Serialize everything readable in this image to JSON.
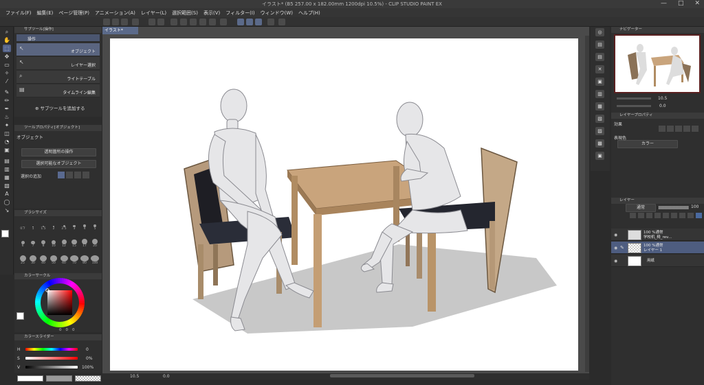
{
  "window": {
    "title": "イラスト* (B5 257.00 x 182.00mm 1200dpi 10.5%) - CLIP STUDIO PAINT EX",
    "controls": [
      "—",
      "□",
      "✕"
    ]
  },
  "menu": [
    "ファイル(F)",
    "編集(E)",
    "ページ管理(P)",
    "アニメーション(A)",
    "レイヤー(L)",
    "選択範囲(S)",
    "表示(V)",
    "フィルター(I)",
    "ウィンドウ(W)",
    "ヘルプ(H)"
  ],
  "subtool_panel": {
    "header": "サブツール[操作]",
    "group_label": "操作",
    "items": [
      "オブジェクト",
      "レイヤー選択",
      "ライトテーブル",
      "タイムライン編集"
    ],
    "add_label": "サブツールを追加する"
  },
  "tool_property": {
    "header": "ツールプロパティ[オブジェクト]",
    "title": "オブジェクト",
    "dropdown1": "透明箇所の操作",
    "dropdown2": "選択可能なオブジェクト",
    "selection_add_label": "選択の追加"
  },
  "brush_size": {
    "header": "ブラシサイズ",
    "sizes": [
      "0.7",
      "1",
      "1.5",
      "2",
      "2.5",
      "3",
      "4",
      "5",
      "6",
      "7",
      "8",
      "10",
      "12",
      "15",
      "17",
      "20",
      "25",
      "30",
      "40",
      "50",
      "60",
      "70",
      "80",
      "100"
    ]
  },
  "color_wheel": {
    "header": "カラーサークル",
    "hue_color": "#ff0000",
    "readout_left": "0",
    "readout_mid": "0",
    "readout_right": "0"
  },
  "color_slider": {
    "header": "カラースライダー",
    "rows": [
      {
        "label": "H",
        "value": "0"
      },
      {
        "label": "S",
        "value": "0%"
      },
      {
        "label": "V",
        "value": "100%"
      }
    ]
  },
  "document": {
    "tab": "イラスト*",
    "zoom": "10.5",
    "rotation": "0.0"
  },
  "navigator": {
    "header": "ナビゲーター",
    "zoom": "10.5",
    "angle": "0.0"
  },
  "layer_property": {
    "header": "レイヤープロパティ",
    "effect_label": "効果",
    "expression_label": "表現色",
    "expression_value": "カラー"
  },
  "layers": {
    "header": "レイヤー",
    "blend": "通常",
    "opacity": "100",
    "rows": [
      {
        "line1": "100 %通常",
        "line2": "学校机_椅_rev..."
      },
      {
        "line1": "100 %通常",
        "line2": "レイヤー 1"
      },
      {
        "line1": "",
        "line2": "用紙"
      }
    ]
  }
}
